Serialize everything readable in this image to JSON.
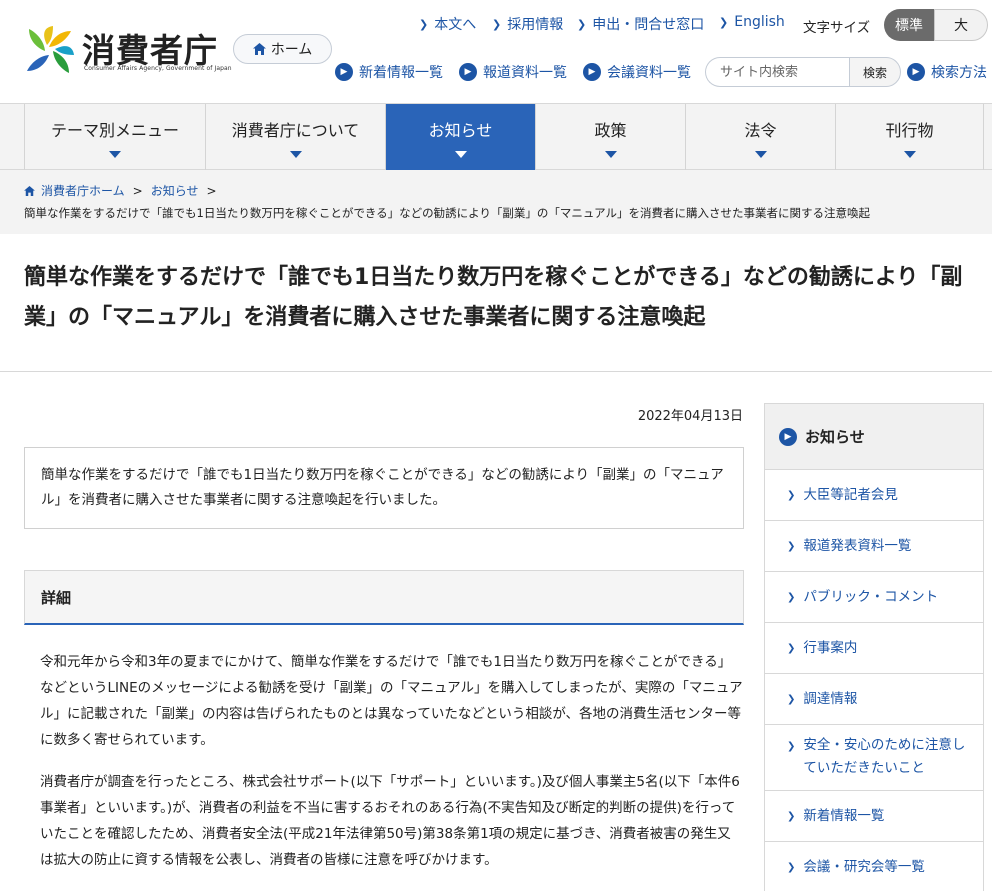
{
  "header": {
    "logo_name": "消費者庁",
    "logo_subtitle": "Consumer Affairs Agency, Government of Japan",
    "home_label": "ホーム",
    "top_links": [
      "本文へ",
      "採用情報",
      "申出・問合せ窓口",
      "English"
    ],
    "font_size_label": "文字サイズ",
    "font_size_standard": "標準",
    "font_size_large": "大",
    "sub_links": [
      "新着情報一覧",
      "報道資料一覧",
      "会議資料一覧"
    ],
    "search_placeholder": "サイト内検索",
    "search_button": "検索",
    "search_help": "検索方法"
  },
  "nav": {
    "items": [
      "テーマ別メニュー",
      "消費者庁について",
      "お知らせ",
      "政策",
      "法令",
      "刊行物"
    ],
    "active": "お知らせ"
  },
  "breadcrumb": {
    "items": [
      "消費者庁ホーム",
      "お知らせ"
    ],
    "current": "簡単な作業をするだけで「誰でも1日当たり数万円を稼ぐことができる」などの勧誘により「副業」の「マニュアル」を消費者に購入させた事業者に関する注意喚起"
  },
  "article": {
    "title": "簡単な作業をするだけで「誰でも1日当たり数万円を稼ぐことができる」などの勧誘により「副業」の「マニュアル」を消費者に購入させた事業者に関する注意喚起",
    "date": "2022年04月13日",
    "summary": "簡単な作業をするだけで「誰でも1日当たり数万円を稼ぐことができる」などの勧誘により「副業」の「マニュアル」を消費者に購入させた事業者に関する注意喚起を行いました。",
    "detail_heading": "詳細",
    "paragraphs": [
      "令和元年から令和3年の夏までにかけて、簡単な作業をするだけで「誰でも1日当たり数万円を稼ぐことができる」などというLINEのメッセージによる勧誘を受け「副業」の「マニュアル」を購入してしまったが、実際の「マニュアル」に記載された「副業」の内容は告げられたものとは異なっていたなどという相談が、各地の消費生活センター等に数多く寄せられています。",
      "消費者庁が調査を行ったところ、株式会社サポート(以下「サポート」といいます。)及び個人事業主5名(以下「本件6事業者」といいます。)が、消費者の利益を不当に害するおそれのある行為(不実告知及び断定的判断の提供)を行っていたことを確認したため、消費者安全法(平成21年法律第50号)第38条第1項の規定に基づき、消費者被害の発生又は拡大の防止に資する情報を公表し、消費者の皆様に注意を呼びかけます。"
    ]
  },
  "sidebar": {
    "heading": "お知らせ",
    "items": [
      "大臣等記者会見",
      "報道発表資料一覧",
      "パブリック・コメント",
      "行事案内",
      "調達情報",
      "安全・安心のために注意していただきたいこと",
      "新着情報一覧",
      "会議・研究会等一覧"
    ]
  },
  "colors": {
    "brand_blue": "#1d55a5",
    "nav_active": "#2a64b8",
    "nav_bg": "#f3f3f3"
  }
}
